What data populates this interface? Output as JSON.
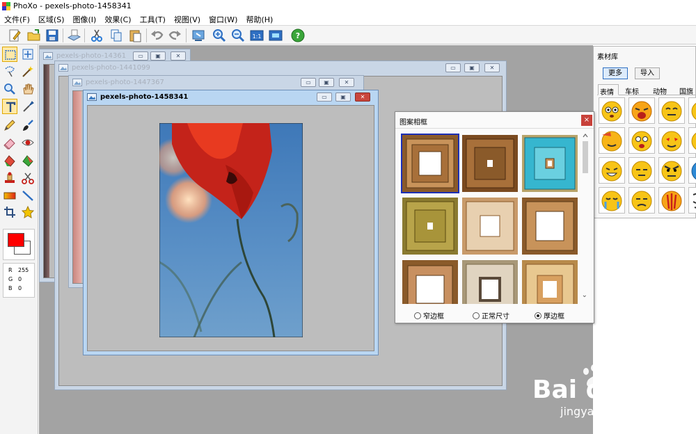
{
  "app": {
    "title": "PhoXo - pexels-photo-1458341"
  },
  "menu": [
    "文件(F)",
    "区域(S)",
    "图像(I)",
    "效果(C)",
    "工具(T)",
    "视图(V)",
    "窗口(W)",
    "帮助(H)"
  ],
  "toolbar": {
    "items": [
      "new-file-icon",
      "open-folder-icon",
      "save-icon",
      "scanner-icon",
      "cut-icon",
      "copy-icon",
      "paste-icon",
      "undo-icon",
      "redo-icon",
      "batch-icon",
      "zoom-in-icon",
      "zoom-out-icon",
      "actual-size-icon",
      "fit-window-icon",
      "help-icon"
    ],
    "actual_size_label": "1:1",
    "help_label": "?"
  },
  "tools": {
    "items": [
      "rect-select-icon",
      "move-icon",
      "lasso-icon",
      "magic-wand-icon",
      "zoom-icon",
      "hand-icon",
      "text-icon",
      "eyedropper-icon",
      "pencil-icon",
      "brush-icon",
      "eraser-icon",
      "red-eye-icon",
      "fill-icon",
      "gradient-fill-icon",
      "clone-stamp-icon",
      "scissors-icon",
      "gradient-icon",
      "line-icon",
      "crop-icon",
      "star-icon"
    ],
    "foreground_color": "#ff0000",
    "background_color": "#ffffff",
    "rgb": {
      "r_label": "R",
      "g_label": "G",
      "b_label": "B",
      "r": "255",
      "g": "0",
      "b": "0"
    }
  },
  "windows": [
    {
      "title": "pexels-photo-14361",
      "active": false
    },
    {
      "title": "pexels-photo-1441099",
      "active": false
    },
    {
      "title": "pexels-photo-1447367",
      "active": false
    },
    {
      "title": "pexels-photo-1458341",
      "active": true
    }
  ],
  "window_buttons": {
    "minimize": "▭",
    "restore": "▣",
    "close": "✕"
  },
  "material_library": {
    "title": "素材库",
    "more_button": "更多",
    "import_button": "导入",
    "tabs": [
      "表情",
      "车标",
      "动物",
      "国旗"
    ],
    "active_tab": "表情"
  },
  "frame_dialog": {
    "title": "图案相框",
    "close": "×",
    "options": [
      "窄边框",
      "正常尺寸",
      "厚边框"
    ],
    "selected_option": "厚边框",
    "scroll_down": "⌄"
  },
  "watermark": {
    "logo": "Bai du 经验",
    "url": "jingyan.baidu.com"
  },
  "colors": {
    "accent": "#1a2fb8",
    "close_red": "#c8413a",
    "workspace": "#a3a3a3"
  }
}
